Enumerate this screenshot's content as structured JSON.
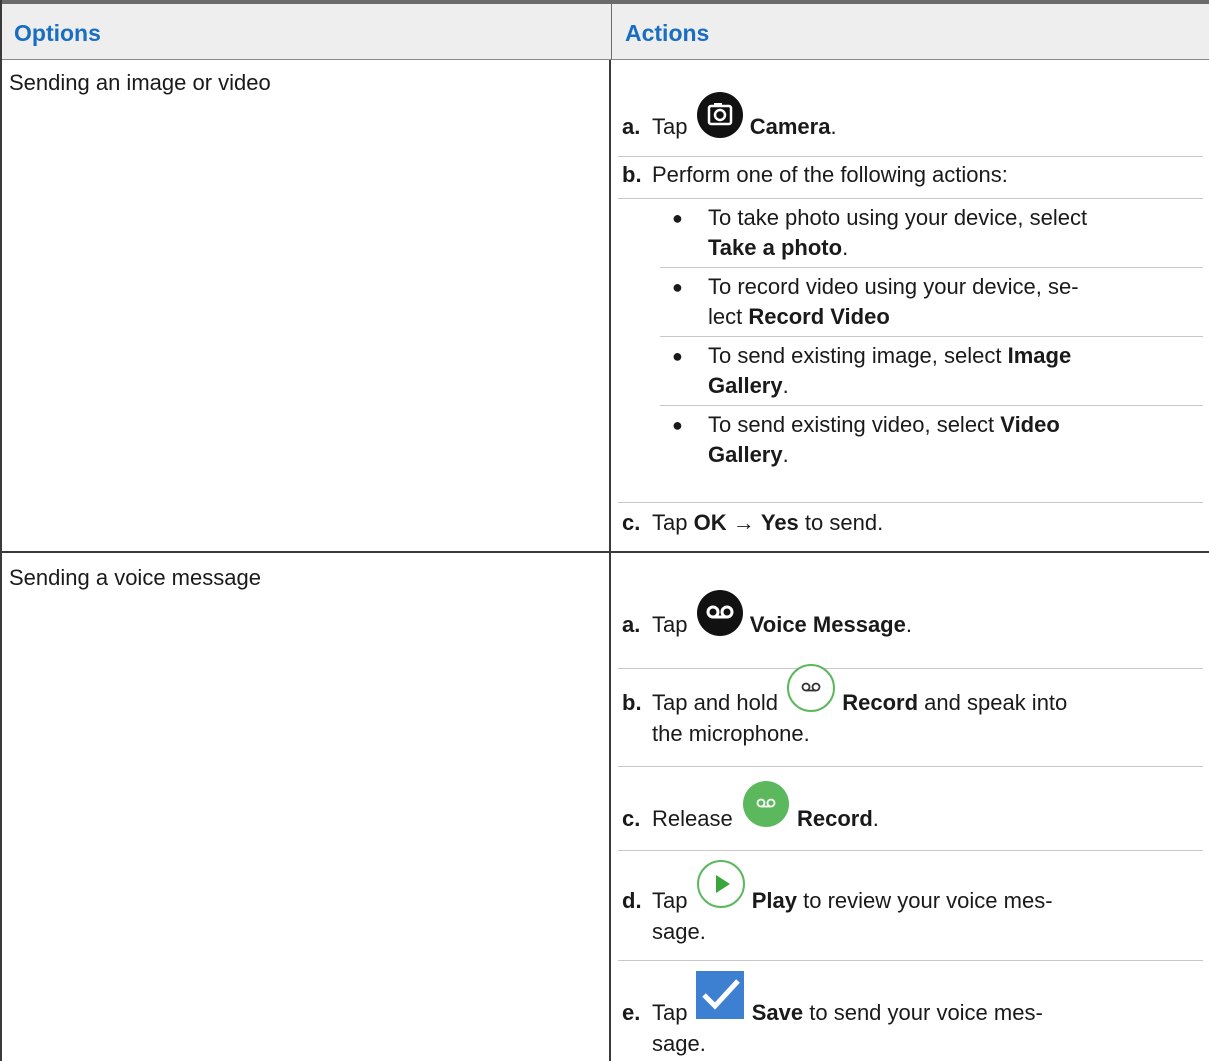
{
  "table": {
    "headers": {
      "options": "Options",
      "actions": "Actions"
    },
    "rows": [
      {
        "option": "Sending an image or video",
        "steps": [
          {
            "letter": "a.",
            "pre": "Tap",
            "icon": "camera-icon",
            "bold": "Camera",
            "post": "."
          },
          {
            "letter": "b.",
            "text": "Perform one of the following actions:"
          },
          {
            "letter": "c.",
            "pre": "Tap",
            "bold1": "OK",
            "arrow": "→",
            "bold2": "Yes",
            "post": "to send."
          }
        ],
        "bullets": [
          {
            "text": "To take photo using your device, select",
            "bold": "Take a photo",
            "post": "."
          },
          {
            "text": "To record video using your device, se-",
            "text2": "lect",
            "bold": "Record Video",
            "post": ""
          },
          {
            "text": "To send existing image, select",
            "bold": "Image",
            "bold_line2": "Gallery",
            "post": "."
          },
          {
            "text": "To send existing video, select",
            "bold": "Video",
            "bold_line2": "Gallery",
            "post": "."
          }
        ]
      },
      {
        "option": "Sending a voice message",
        "steps": [
          {
            "letter": "a.",
            "pre": "Tap",
            "icon": "voicemail-icon",
            "bold": "Voice Message",
            "post": "."
          },
          {
            "letter": "b.",
            "pre": "Tap and hold",
            "icon": "record-outline-icon",
            "bold": "Record",
            "post": "and speak into",
            "line2": "the microphone."
          },
          {
            "letter": "c.",
            "pre": "Release",
            "icon": "record-filled-icon",
            "bold": "Record",
            "post": "."
          },
          {
            "letter": "d.",
            "pre": "Tap",
            "icon": "play-icon",
            "bold": "Play",
            "post": "to review your voice mes-",
            "line2": "sage."
          },
          {
            "letter": "e.",
            "pre": "Tap",
            "icon": "checkmark-icon",
            "bold": "Save",
            "post": "to send your voice mes-",
            "line2": "sage."
          }
        ]
      }
    ]
  },
  "colors": {
    "header_text": "#1a6ec2",
    "header_bg": "#eeeeee",
    "icon_black": "#111111",
    "icon_green": "#5cb85c",
    "icon_blue": "#3d7fd1"
  }
}
